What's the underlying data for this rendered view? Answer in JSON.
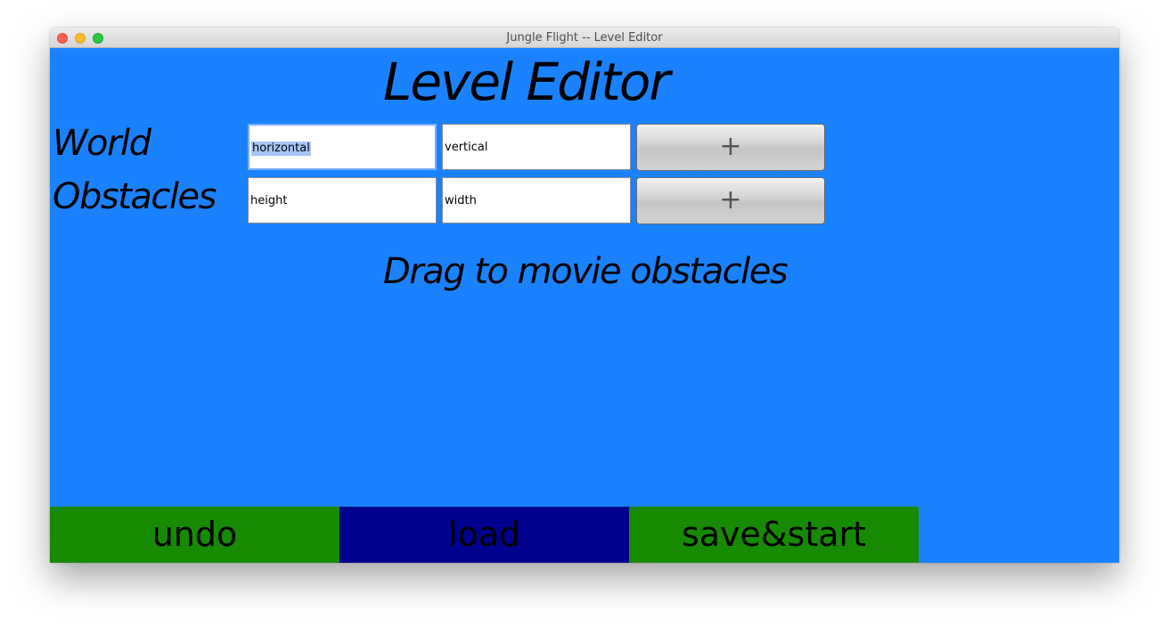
{
  "window": {
    "title": "Jungle Flight -- Level Editor"
  },
  "heading": "Level Editor",
  "world": {
    "label": "World",
    "horizontal_value": "horizontal",
    "vertical_value": "vertical",
    "add_label": "+"
  },
  "obstacles": {
    "label": "Obstacles",
    "height_value": "height",
    "width_value": "width",
    "add_label": "+"
  },
  "hint": "Drag to movie obstacles",
  "buttons": {
    "undo": "undo",
    "load": "load",
    "save_start": "save&start"
  },
  "colors": {
    "background": "#1b82ff",
    "undo": "#168a00",
    "load": "#00008e",
    "save_start": "#168a00"
  }
}
